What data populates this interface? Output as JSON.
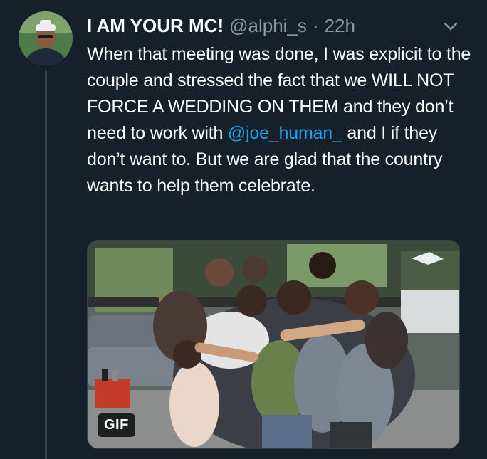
{
  "tweet": {
    "display_name": "I AM YOUR MC!",
    "handle": "@alphi_s",
    "separator": "·",
    "time": "22h",
    "text_before_mention": "When that meeting was done, I was explicit to the couple and stressed the fact that we WILL NOT FORCE A WEDDING ON THEM and they don’t need to work with ",
    "mention": "@joe_human_",
    "text_after_mention": " and I if they don’t want to. But we are glad that the country wants to help them celebrate.",
    "media_badge": "GIF"
  },
  "icons": {
    "menu": "chevron-down-icon",
    "avatar": "avatar"
  },
  "colors": {
    "background": "#15202b",
    "text": "#ffffff",
    "secondary_text": "#8899a6",
    "link": "#1da1f2",
    "thread_line": "#38444d"
  }
}
